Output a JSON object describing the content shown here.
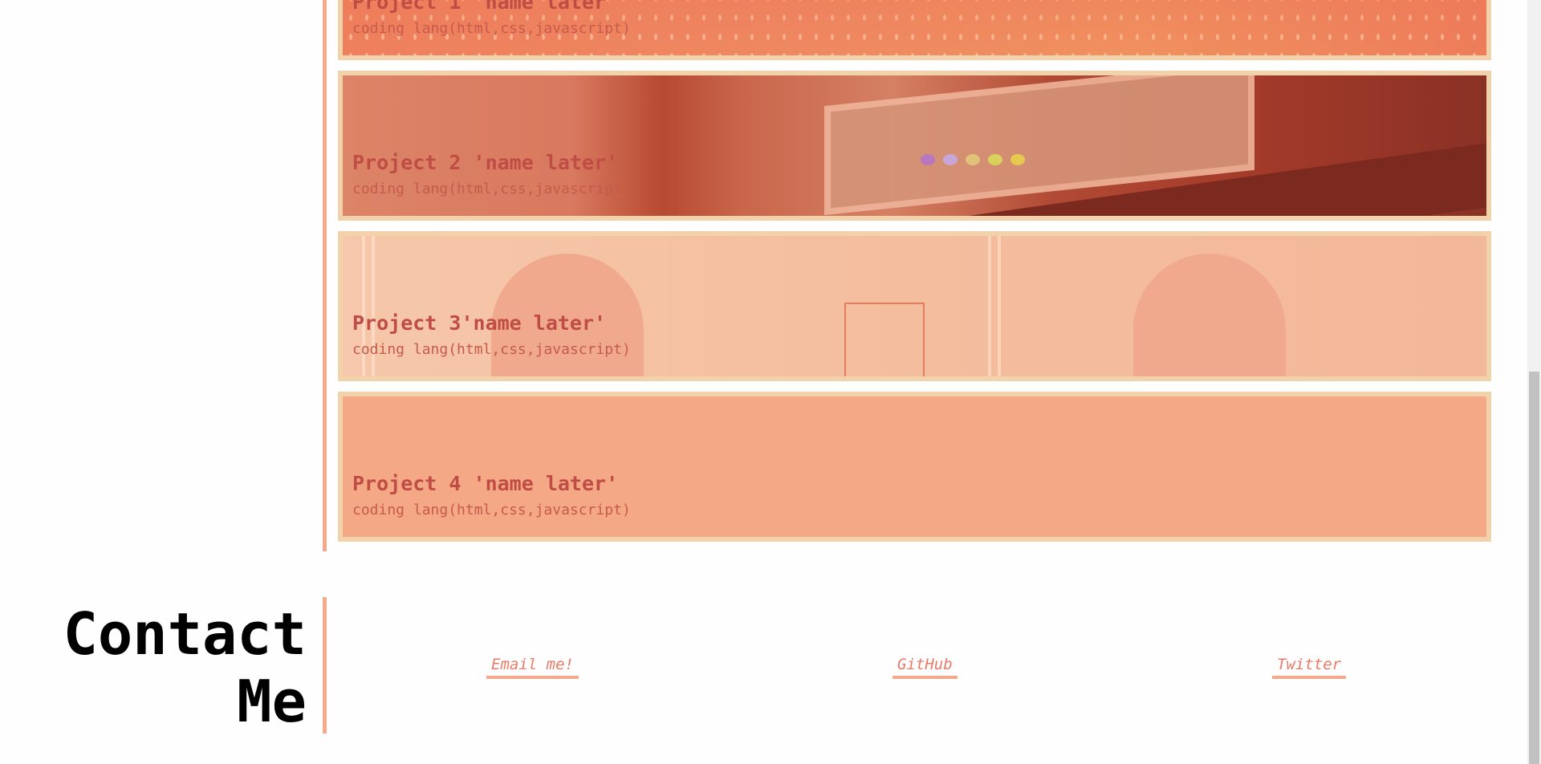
{
  "projects": [
    {
      "title": "Project 1 'name later'",
      "subtitle": "coding lang(html,css,javascript)"
    },
    {
      "title": "Project 2 'name later'",
      "subtitle": "coding lang(html,css,javascript)"
    },
    {
      "title": "Project 3'name later'",
      "subtitle": "coding lang(html,css,javascript)"
    },
    {
      "title": "Project 4 'name later'",
      "subtitle": "coding lang(html,css,javascript)"
    }
  ],
  "contact": {
    "title_line1": "Contact",
    "title_line2": "Me",
    "links": [
      {
        "label": "Email me!"
      },
      {
        "label": "GitHub"
      },
      {
        "label": "Twitter"
      }
    ]
  },
  "colors": {
    "accent": "#f4a98a",
    "card_border": "#f1d2aa",
    "project_title": "#c04d45",
    "link": "#e97a68"
  }
}
